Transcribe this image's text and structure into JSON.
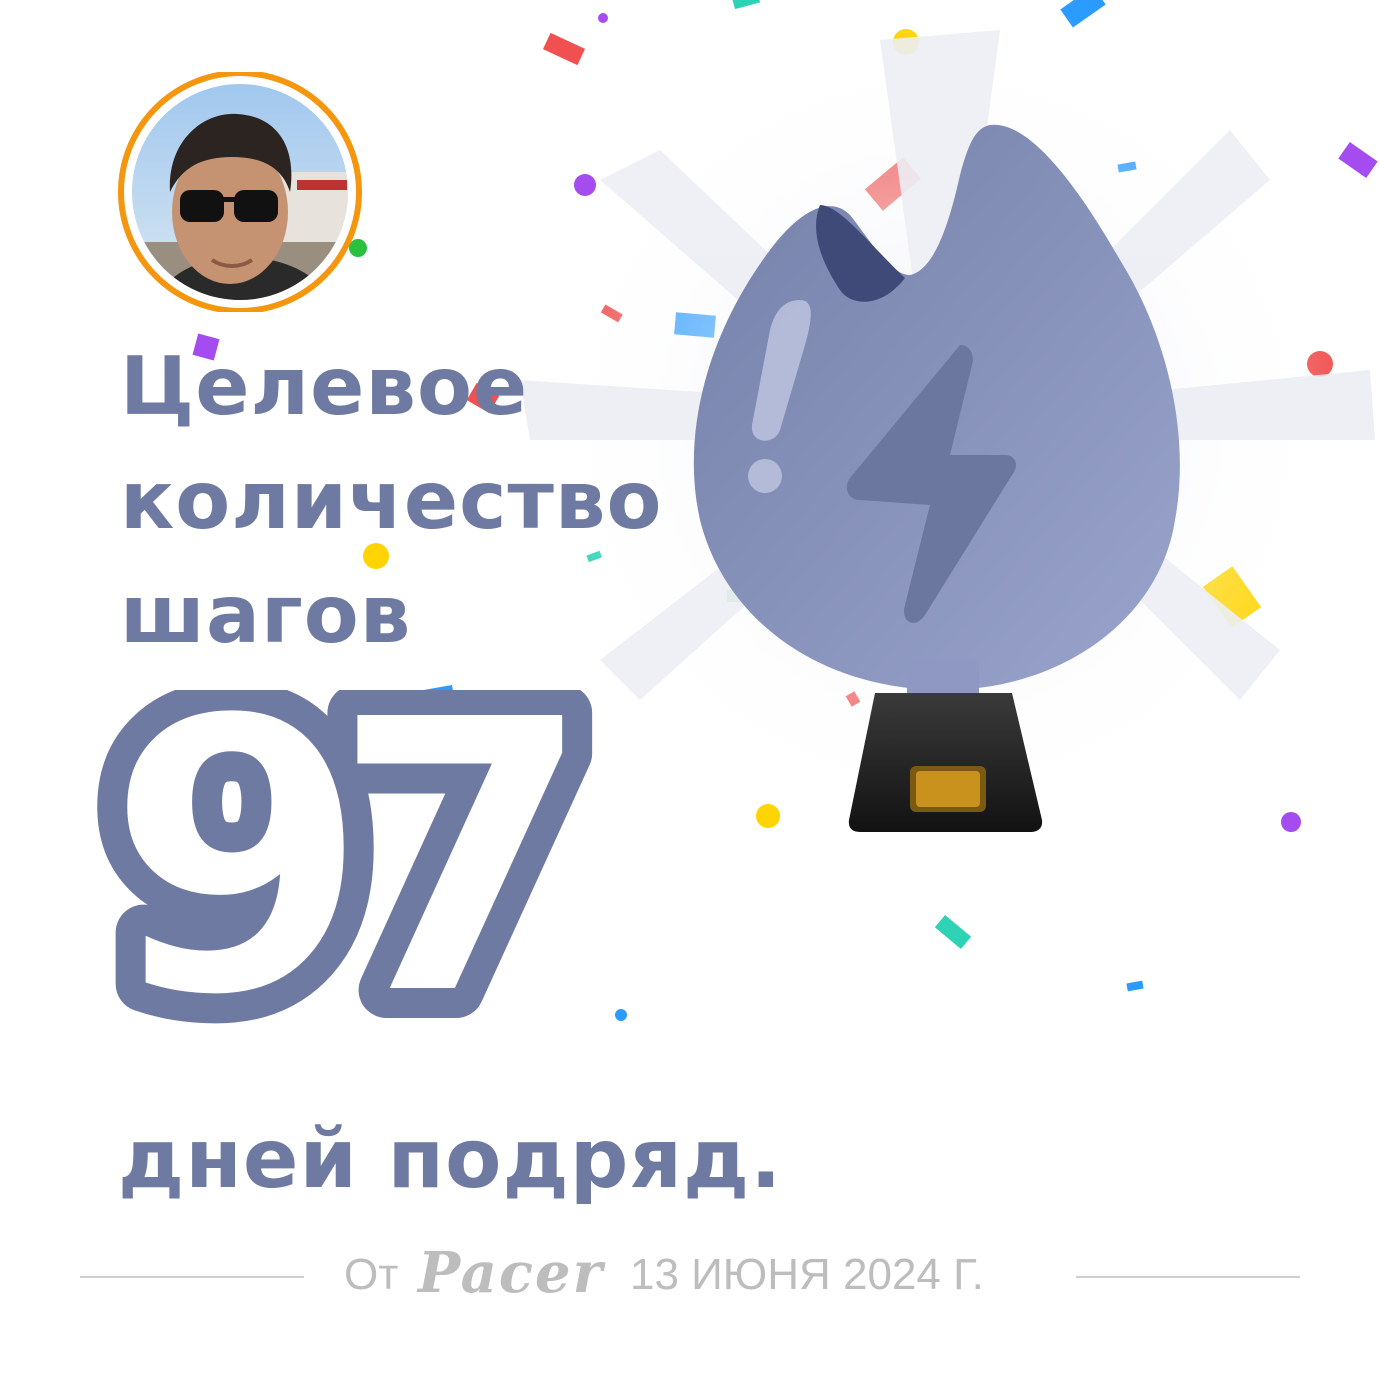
{
  "title_lines": [
    "Целевое",
    "количество",
    "шагов"
  ],
  "streak_number": "97",
  "subtitle": "дней подряд.",
  "footer": {
    "from_label": "От",
    "brand": "Pacer",
    "date": "13 ИЮНЯ 2024 Г."
  },
  "colors": {
    "text": "#6e7aa1",
    "avatar_ring": "#f5960f",
    "trophy_body": "#8a95be",
    "trophy_base": "#1e1e1e",
    "plate": "#c8921c",
    "footer_gray": "#bdbdbd"
  },
  "icons": {
    "trophy": "lightning-trophy-icon",
    "avatar": "user-avatar"
  }
}
